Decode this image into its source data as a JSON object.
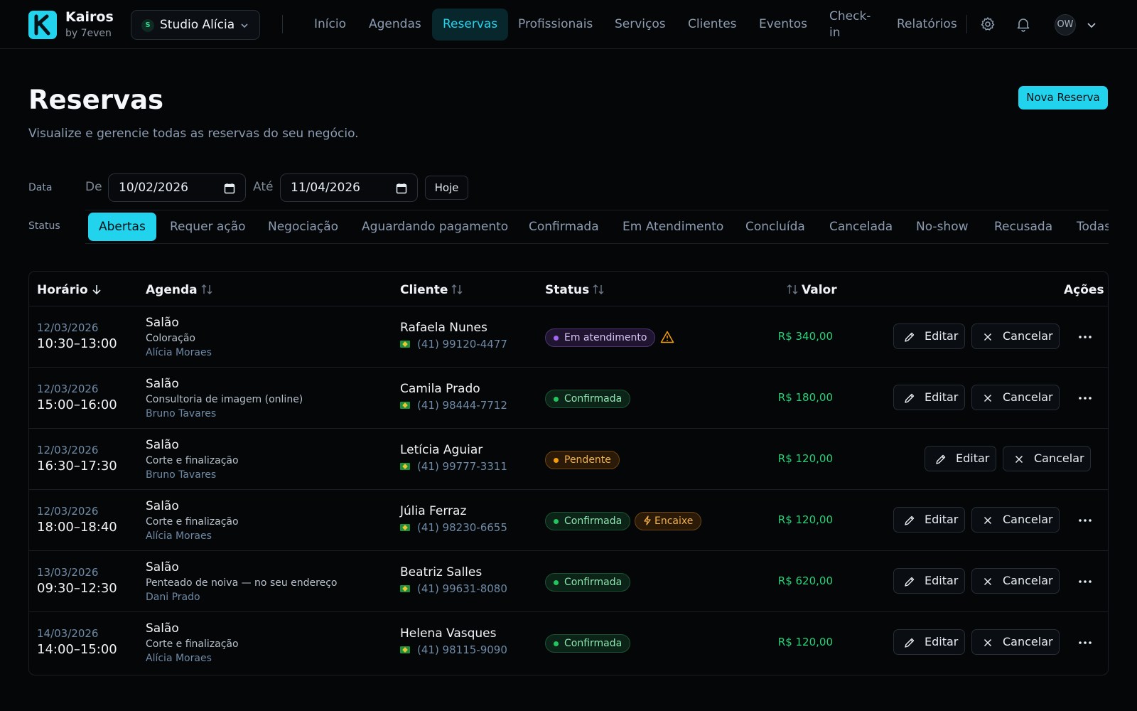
{
  "brand": {
    "name": "Kairos",
    "sub": "by 7even"
  },
  "studio": {
    "initial": "S",
    "name": "Studio Alícia"
  },
  "nav": [
    {
      "label": "Início",
      "active": false
    },
    {
      "label": "Agendas",
      "active": false
    },
    {
      "label": "Reservas",
      "active": true
    },
    {
      "label": "Profissionais",
      "active": false
    },
    {
      "label": "Serviços",
      "active": false
    },
    {
      "label": "Clientes",
      "active": false
    },
    {
      "label": "Eventos",
      "active": false
    },
    {
      "label": "Check-in",
      "active": false
    },
    {
      "label": "Relatórios",
      "active": false
    }
  ],
  "user": {
    "initials": "OW"
  },
  "header": {
    "title": "Reservas",
    "subtitle": "Visualize e gerencie todas as reservas do seu negócio.",
    "new_button": "Nova Reserva"
  },
  "filters": {
    "date_label": "Data",
    "from_label": "De",
    "from_value": "10/02/2026",
    "to_label": "Até",
    "to_value": "11/04/2026",
    "today_button": "Hoje",
    "status_label": "Status",
    "status_tabs": [
      "Abertas",
      "Requer ação",
      "Negociação",
      "Aguardando pagamento",
      "Confirmada",
      "Em Atendimento",
      "Concluída",
      "Cancelada",
      "No-show",
      "Recusada",
      "Todas"
    ],
    "status_active": "Abertas"
  },
  "table": {
    "columns": {
      "horario": "Horário",
      "agenda": "Agenda",
      "cliente": "Cliente",
      "status": "Status",
      "valor": "Valor",
      "acoes": "Ações"
    },
    "edit_label": "Editar",
    "cancel_label": "Cancelar",
    "rows": [
      {
        "date": "12/03/2026",
        "time": "10:30–13:00",
        "agenda": "Salão",
        "service": "Coloração",
        "professional": "Alícia Moraes",
        "client": "Rafaela Nunes",
        "phone": "(41) 99120-4477",
        "status": "Em atendimento",
        "status_color": "purple",
        "warning": true,
        "tag": "",
        "valor": "R$ 340,00",
        "more": true
      },
      {
        "date": "12/03/2026",
        "time": "15:00–16:00",
        "agenda": "Salão",
        "service": "Consultoria de imagem (online)",
        "professional": "Bruno Tavares",
        "client": "Camila Prado",
        "phone": "(41) 98444-7712",
        "status": "Confirmada",
        "status_color": "green",
        "warning": false,
        "tag": "",
        "valor": "R$ 180,00",
        "more": true
      },
      {
        "date": "12/03/2026",
        "time": "16:30–17:30",
        "agenda": "Salão",
        "service": "Corte e finalização",
        "professional": "Bruno Tavares",
        "client": "Letícia Aguiar",
        "phone": "(41) 99777-3311",
        "status": "Pendente",
        "status_color": "amber",
        "warning": false,
        "tag": "",
        "valor": "R$ 120,00",
        "more": false
      },
      {
        "date": "12/03/2026",
        "time": "18:00–18:40",
        "agenda": "Salão",
        "service": "Corte e finalização",
        "professional": "Alícia Moraes",
        "client": "Júlia Ferraz",
        "phone": "(41) 98230-6655",
        "status": "Confirmada",
        "status_color": "green",
        "warning": false,
        "tag": "Encaixe",
        "valor": "R$ 120,00",
        "more": true
      },
      {
        "date": "13/03/2026",
        "time": "09:30–12:30",
        "agenda": "Salão",
        "service": "Penteado de noiva — no seu endereço",
        "professional": "Dani Prado",
        "client": "Beatriz Salles",
        "phone": "(41) 99631-8080",
        "status": "Confirmada",
        "status_color": "green",
        "warning": false,
        "tag": "",
        "valor": "R$ 620,00",
        "more": true
      },
      {
        "date": "14/03/2026",
        "time": "14:00–15:00",
        "agenda": "Salão",
        "service": "Corte e finalização",
        "professional": "Alícia Moraes",
        "client": "Helena Vasques",
        "phone": "(41) 98115-9090",
        "status": "Confirmada",
        "status_color": "green",
        "warning": false,
        "tag": "",
        "valor": "R$ 120,00",
        "more": true
      }
    ]
  },
  "icons": [
    "k-logo-icon",
    "chevron-down-icon",
    "gear-icon",
    "bell-icon",
    "calendar-icon",
    "sort-desc-icon",
    "sort-icon",
    "pencil-icon",
    "close-icon",
    "more-icon",
    "warning-icon",
    "bolt-icon",
    "flag-icon"
  ],
  "colors": {
    "accent": "#22d3ee",
    "background": "#050607",
    "money": "#27d37a",
    "purple": "#a463f2",
    "green": "#22c55e",
    "amber": "#f59e0b"
  }
}
